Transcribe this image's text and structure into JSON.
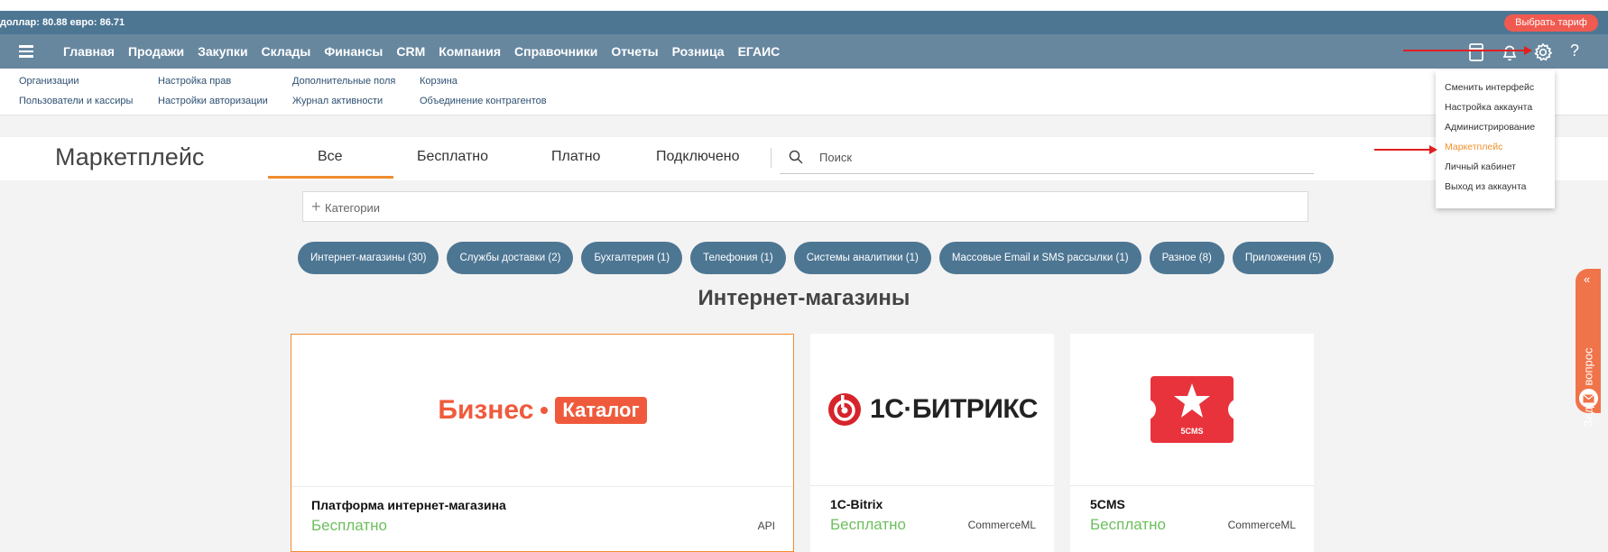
{
  "topbar": {
    "rates": "доллар: 80.88   евро: 86.71",
    "tariff_button": "Выбрать тариф"
  },
  "nav": {
    "items": [
      "Главная",
      "Продажи",
      "Закупки",
      "Склады",
      "Финансы",
      "CRM",
      "Компания",
      "Справочники",
      "Отчеты",
      "Розница",
      "ЕГАИС"
    ],
    "help": "?"
  },
  "submenu": {
    "col1": [
      "Организации",
      "Пользователи и кассиры"
    ],
    "col2": [
      "Настройка прав",
      "Настройки авторизации"
    ],
    "col3": [
      "Дополнительные поля",
      "Журнал активности"
    ],
    "col4": [
      "Корзина",
      "Объединение контрагентов"
    ]
  },
  "marketplace": {
    "title": "Маркетплейс",
    "tabs": [
      "Все",
      "Бесплатно",
      "Платно",
      "Подключено"
    ],
    "active_tab": "Все",
    "search_placeholder": "Поиск",
    "categories_placeholder": "Категории",
    "pills": [
      "Интернет-магазины (30)",
      "Службы доставки (2)",
      "Бухгалтерия (1)",
      "Телефония (1)",
      "Системы аналитики (1)",
      "Массовые Email и SMS рассылки (1)",
      "Разное (8)",
      "Приложения (5)"
    ],
    "section_title": "Интернет-магазины",
    "cards": [
      {
        "logo_text_1": "Бизнес",
        "logo_text_2": "Каталог",
        "name": "Платформа интернет-магазина",
        "price": "Бесплатно",
        "tag": "API"
      },
      {
        "logo_text": "1С·БИТРИКС",
        "name": "1C-Bitrix",
        "price": "Бесплатно",
        "tag": "CommerceML"
      },
      {
        "logo_text": "5CMS",
        "name": "5CMS",
        "price": "Бесплатно",
        "tag": "CommerceML"
      }
    ]
  },
  "dropdown": {
    "items": [
      "Сменить интерфейс",
      "Настройка аккаунта",
      "Администрирование",
      "Маркетплейс",
      "Личный кабинет",
      "Выход из аккаунта"
    ],
    "highlighted": "Маркетплейс"
  },
  "ask_tab": {
    "label": "Задать вопрос",
    "chevron": "«"
  },
  "colors": {
    "topbar": "#4d7693",
    "navbar": "#67879f",
    "accent_orange": "#f08c30",
    "price_green": "#6cbf5c",
    "pill": "#4d7693",
    "arrow_red": "#e02020"
  }
}
